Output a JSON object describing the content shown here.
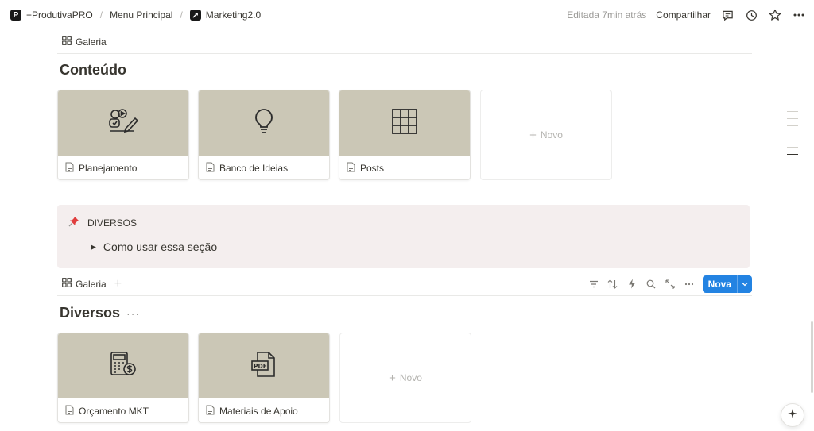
{
  "breadcrumb": {
    "workspace": "+ProdutivaPRO",
    "separator": "/",
    "parent": "Menu Principal",
    "page": "Marketing2.0"
  },
  "header": {
    "edited": "Editada 7min atrás",
    "share": "Compartilhar"
  },
  "gallery1": {
    "view_label": "Galeria",
    "title": "Conteúdo",
    "cards": [
      {
        "label": "Planejamento",
        "icon": "planning-icon"
      },
      {
        "label": "Banco de Ideias",
        "icon": "lightbulb-icon"
      },
      {
        "label": "Posts",
        "icon": "grid-icon"
      }
    ],
    "new_label": "Novo"
  },
  "callout": {
    "emoji": "pushpin",
    "title": "DIVERSOS",
    "toggle_label": "Como usar essa seção"
  },
  "gallery2": {
    "view_label": "Galeria",
    "title": "Diversos",
    "more": "···",
    "new_button": "Nova",
    "cards": [
      {
        "label": "Orçamento MKT",
        "icon": "calculator-icon"
      },
      {
        "label": "Materiais de Apoio",
        "icon": "pdf-icon"
      }
    ],
    "new_label": "Novo"
  },
  "colors": {
    "cover": "#cbc7b6",
    "callout_bg": "#f4eeee",
    "accent": "#2383e2",
    "pin": "#e03e3e"
  }
}
